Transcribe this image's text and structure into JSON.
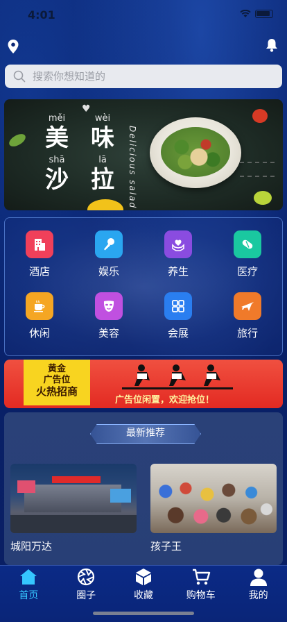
{
  "status_bar": {
    "time": "4:01"
  },
  "search": {
    "placeholder": "搜索你想知道的"
  },
  "banner": {
    "pinyin": [
      "měi",
      "wèi",
      "shā",
      "lā"
    ],
    "chars": [
      "美",
      "味",
      "沙",
      "拉"
    ],
    "subtitle": "Delicious salad"
  },
  "categories": [
    {
      "label": "酒店",
      "icon": "hotel-icon",
      "color": "#f0405a"
    },
    {
      "label": "娱乐",
      "icon": "microphone-icon",
      "color": "#2aa6f0"
    },
    {
      "label": "养生",
      "icon": "heart-hands-icon",
      "color": "#8a4ce0"
    },
    {
      "label": "医疗",
      "icon": "pill-icon",
      "color": "#1ac8a0"
    },
    {
      "label": "休闲",
      "icon": "coffee-icon",
      "color": "#f5a623"
    },
    {
      "label": "美容",
      "icon": "mask-icon",
      "color": "#c050e0"
    },
    {
      "label": "会展",
      "icon": "grid-icon",
      "color": "#2a7ef0"
    },
    {
      "label": "旅行",
      "icon": "plane-icon",
      "color": "#f07a2a"
    }
  ],
  "ad": {
    "gold_lines": [
      "黄金",
      "广告位",
      "火热招商"
    ],
    "slogan": "广告位闲置，欢迎抢位！"
  },
  "recommend": {
    "title": "最新推荐",
    "items": [
      {
        "name": "城阳万达"
      },
      {
        "name": "孩子王"
      }
    ]
  },
  "tabbar": {
    "tabs": [
      {
        "label": "首页",
        "icon": "home-icon",
        "active": true
      },
      {
        "label": "圈子",
        "icon": "aperture-icon",
        "active": false
      },
      {
        "label": "收藏",
        "icon": "box-icon",
        "active": false
      },
      {
        "label": "购物车",
        "icon": "cart-icon",
        "active": false
      },
      {
        "label": "我的",
        "icon": "user-icon",
        "active": false
      }
    ]
  }
}
